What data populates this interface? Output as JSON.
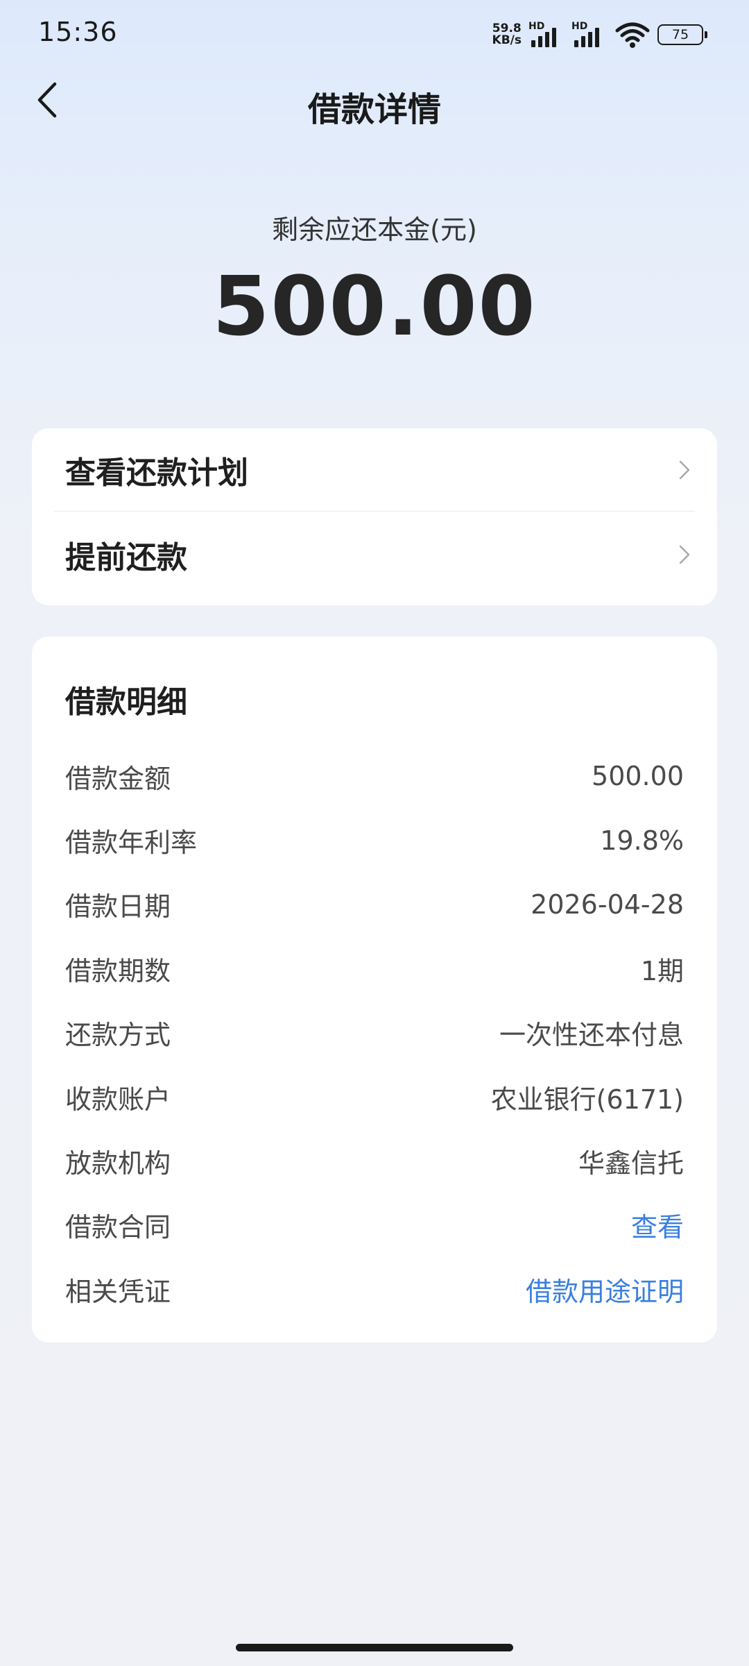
{
  "status_bar": {
    "time": "15:36",
    "net_speed_value": "59.8",
    "net_speed_unit": "KB/s",
    "sim1_label": "HD",
    "sim2_label": "HD",
    "battery_level": "75"
  },
  "header": {
    "title": "借款详情",
    "back_icon": "chevron-left-icon"
  },
  "summary": {
    "label": "剩余应还本金(元)",
    "amount": "500.00"
  },
  "actions": [
    {
      "label": "查看还款计划",
      "icon": "chevron-right-icon"
    },
    {
      "label": "提前还款",
      "icon": "chevron-right-icon"
    }
  ],
  "details": {
    "title": "借款明细",
    "rows": [
      {
        "label": "借款金额",
        "value": "500.00"
      },
      {
        "label": "借款年利率",
        "value": "19.8%"
      },
      {
        "label": "借款日期",
        "value": "2026-04-28"
      },
      {
        "label": "借款期数",
        "value": "1期"
      },
      {
        "label": "还款方式",
        "value": "一次性还本付息"
      },
      {
        "label": "收款账户",
        "value": "农业银行(6171)"
      },
      {
        "label": "放款机构",
        "value": "华鑫信托"
      },
      {
        "label": "借款合同",
        "value": "查看"
      },
      {
        "label": "相关凭证",
        "value": "借款用途证明"
      }
    ]
  },
  "colors": {
    "link": "#3a7fe0",
    "card_bg": "#ffffff",
    "page_bg_top": "#dde9fb",
    "page_bg_bottom": "#eff1f6"
  }
}
